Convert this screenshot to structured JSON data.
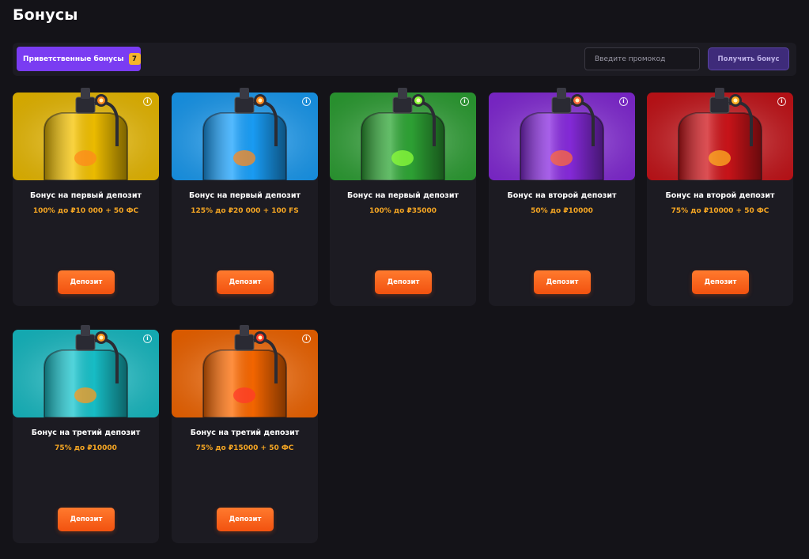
{
  "page": {
    "title": "Бонусы"
  },
  "toolbar": {
    "tab_label": "Приветственные бонусы",
    "tab_count": "7",
    "promo_placeholder": "Введите промокод",
    "get_bonus_label": "Получить бонус"
  },
  "cards": [
    {
      "title": "Бонус на первый депозит",
      "desc": "100% до ₽10 000 + 50 ФС",
      "button": "Депозит",
      "color": "#f7c400",
      "accent": "#ff8a1c"
    },
    {
      "title": "Бонус на первый депозит",
      "desc": "125% до ₽20 000 + 100 FS",
      "button": "Депозит",
      "color": "#1aa3ff",
      "accent": "#ff8a1c"
    },
    {
      "title": "Бонус на первый депозит",
      "desc": "100% до ₽35000",
      "button": "Депозит",
      "color": "#2fa836",
      "accent": "#8dff3a"
    },
    {
      "title": "Бонус на второй депозит",
      "desc": "50% до ₽10000",
      "button": "Депозит",
      "color": "#8a2be2",
      "accent": "#ff6a3a"
    },
    {
      "title": "Бонус на второй депозит",
      "desc": "75% до ₽10000 + 50 ФС",
      "button": "Депозит",
      "color": "#d1141a",
      "accent": "#ffb020"
    },
    {
      "title": "Бонус на третий депозит",
      "desc": "75% до ₽10000",
      "button": "Депозит",
      "color": "#18c6cf",
      "accent": "#ff9a1c"
    },
    {
      "title": "Бонус на третий депозит",
      "desc": "75% до ₽15000 + 50 ФС",
      "button": "Депозит",
      "color": "#ff6a00",
      "accent": "#ff3a2a"
    }
  ]
}
